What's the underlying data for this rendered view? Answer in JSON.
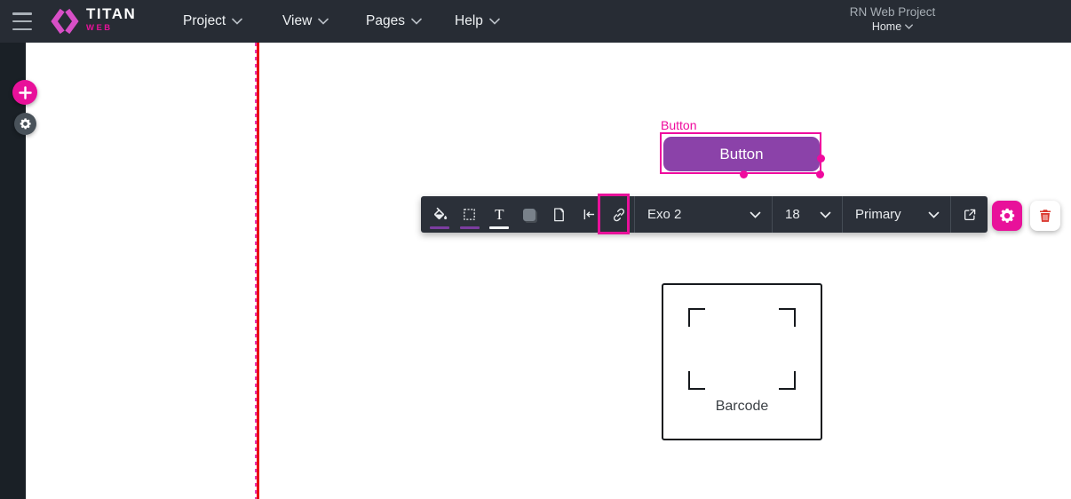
{
  "navbar": {
    "brand": {
      "title": "TITAN",
      "subtitle": "WEB"
    },
    "menus": [
      {
        "label": "Project"
      },
      {
        "label": "View"
      },
      {
        "label": "Pages"
      },
      {
        "label": "Help"
      }
    ],
    "project_name": "RN Web Project",
    "current_page": "Home"
  },
  "sidebar": {
    "buttons": [
      {
        "name": "add-element",
        "icon": "plus-icon"
      },
      {
        "name": "settings",
        "icon": "gear-icon"
      }
    ]
  },
  "toolbar": {
    "icons": [
      "fill-icon",
      "border-icon",
      "text-style-icon",
      "shadow-icon",
      "page-icon",
      "spacing-icon",
      "link-icon"
    ],
    "highlighted_icon": "link-icon",
    "font_family": "Exo 2",
    "font_size": "18",
    "style_preset": "Primary",
    "actions": [
      "open-external-icon",
      "settings-gear-icon",
      "delete-trash-icon"
    ]
  },
  "canvas": {
    "selected_element_label": "Button",
    "button_text": "Button",
    "barcode_label": "Barcode"
  },
  "colors": {
    "accent_pink": "#e8119a",
    "logo_pink": "#d84fc7",
    "button_purple": "#8b42a9",
    "selection_pink": "#ef0a9e",
    "guide_red": "#ea0614",
    "guide_dash_pink": "#e83bb5",
    "delete_red": "#da352b",
    "navbar_bg": "#272c34",
    "toolbar_bg": "#2b3039"
  }
}
